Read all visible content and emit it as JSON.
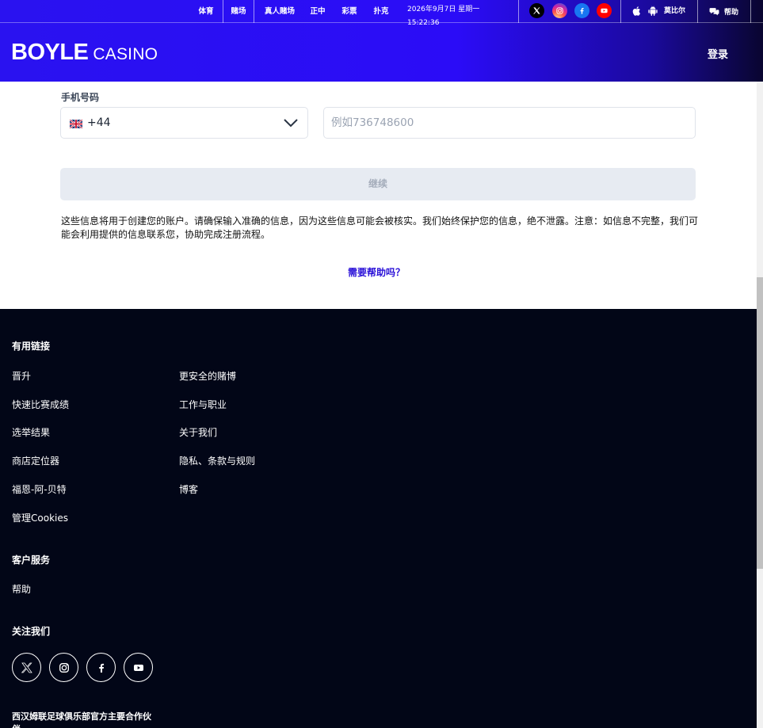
{
  "topnav": {
    "items": [
      "体育",
      "赌场",
      "真人赌场",
      "正中",
      "彩票",
      "扑克"
    ],
    "date": "2026年9月7日 星期一",
    "time": "15:22:36",
    "language": "莫比尔",
    "help": "帮助"
  },
  "icons": {
    "x": "x-icon",
    "instagram": "instagram-icon",
    "facebook": "facebook-icon",
    "youtube": "youtube-icon",
    "apple": "apple-icon",
    "android": "android-icon",
    "chat": "chat-icon"
  },
  "colors": {
    "brand": "#2b0cf7",
    "footer_bg": "#020617",
    "link_blue": "#2b12d8",
    "instagram": "#d6249f",
    "facebook": "#1877f2",
    "youtube": "#ff0000"
  },
  "header": {
    "logo_bold": "BOYLE",
    "logo_light": "CASINO",
    "login": "登录"
  },
  "form": {
    "phone_label": "手机号码",
    "country_code": "+44",
    "country_flag": "uk-flag-icon",
    "phone_placeholder": "例如736748600",
    "phone_value": "",
    "continue": "继续",
    "disclaimer": "这些信息将用于创建您的账户。请确保输入准确的信息，因为这些信息可能会被核实。我们始终保护您的信息，绝不泄露。注意：如信息不完整，我们可能会利用提供的信息联系您，协助完成注册流程。",
    "need_help": "需要帮助吗？"
  },
  "footer": {
    "useful_links_heading": "有用链接",
    "col1": [
      "晋升",
      "快速比赛成绩",
      "选举结果",
      "商店定位器",
      "福恩-阿-贝特",
      "管理Cookies"
    ],
    "col2": [
      "更安全的赌博",
      "工作与职业",
      "关于我们",
      "隐私、条款与规则",
      "博客"
    ],
    "customer_service_heading": "客户服务",
    "help_link": "帮助",
    "follow_heading": "关注我们",
    "partner_text": "西汉姆联足球俱乐部官方主要合作伙伴"
  }
}
